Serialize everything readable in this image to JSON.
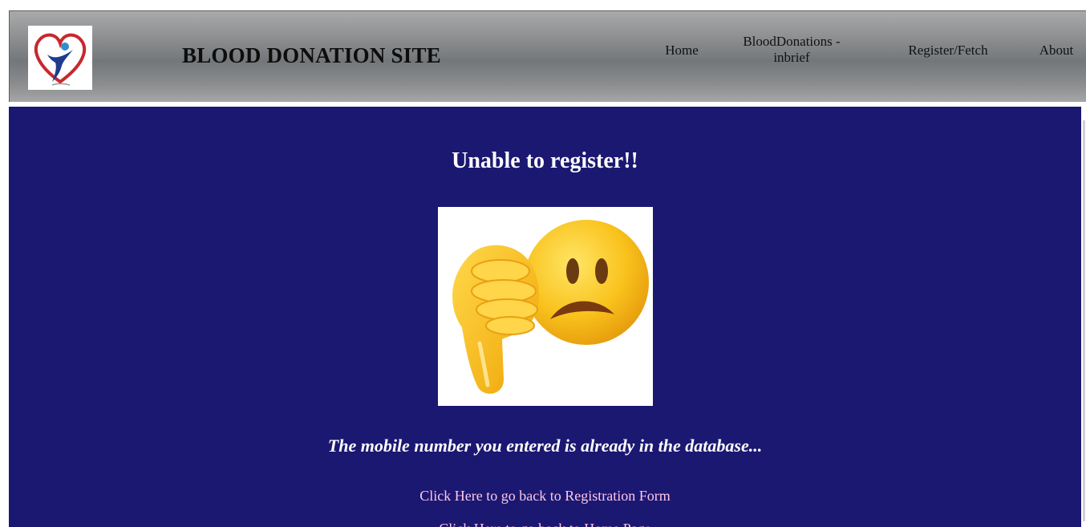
{
  "header": {
    "site_title": "BLOOD DONATION SITE",
    "logo_icon": "heart-person-logo-icon",
    "nav": {
      "home": "Home",
      "blood_donations_line1": "BloodDonations -",
      "blood_donations_line2": "inbrief",
      "register_fetch": "Register/Fetch",
      "about": "About"
    }
  },
  "main": {
    "heading": "Unable to register!!",
    "image_icon": "thumbs-down-sad-emoji-icon",
    "message": "The mobile number you entered is already in the database...",
    "links": {
      "registration": "Click Here to go back to Registration Form",
      "home": "Click Here to go back to Home Page"
    }
  },
  "colors": {
    "header_gradient_mid": "#74777a",
    "main_background": "#1b1872",
    "link_color": "#ffc8e6",
    "heading_color": "#ffffff"
  }
}
